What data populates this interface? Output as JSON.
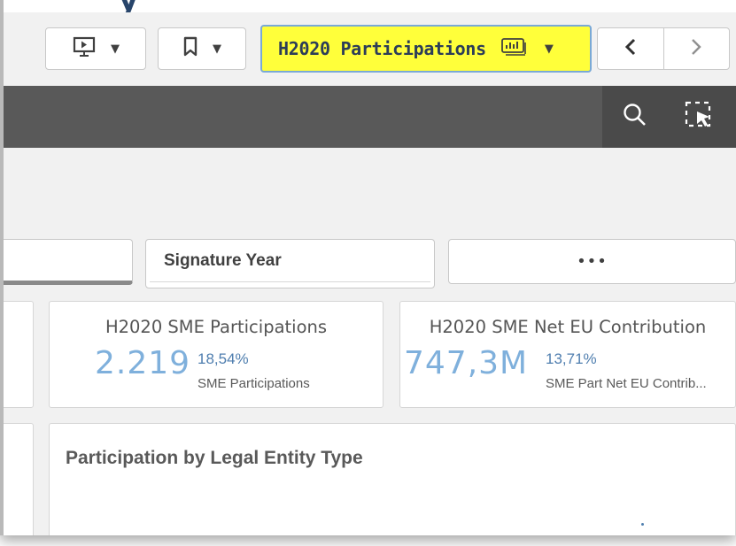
{
  "toolbar": {
    "sheet_title": "H2020 Participations",
    "highlight_color": "#ffff3a"
  },
  "filters": {
    "signature_year_label": "Signature Year",
    "more_label": "•••"
  },
  "kpis": [
    {
      "title": "H2020 SME Participations",
      "value": "2.219",
      "percent": "18,54%",
      "sub_label": "SME Participations"
    },
    {
      "title": "H2020 SME Net EU Contribution",
      "value": "747,3M",
      "percent": "13,71%",
      "sub_label": "SME Part Net EU Contrib..."
    }
  ],
  "chart": {
    "title": "Participation by Legal Entity Type"
  },
  "colors": {
    "dark_bar": "#595959",
    "kpi_value": "#7fb0dc",
    "kpi_percent": "#4f7eaf"
  },
  "icons": [
    "present-icon",
    "bookmark-icon",
    "sheet-chart-icon",
    "chevron-left-icon",
    "chevron-right-icon",
    "search-icon",
    "selection-tool-icon"
  ]
}
